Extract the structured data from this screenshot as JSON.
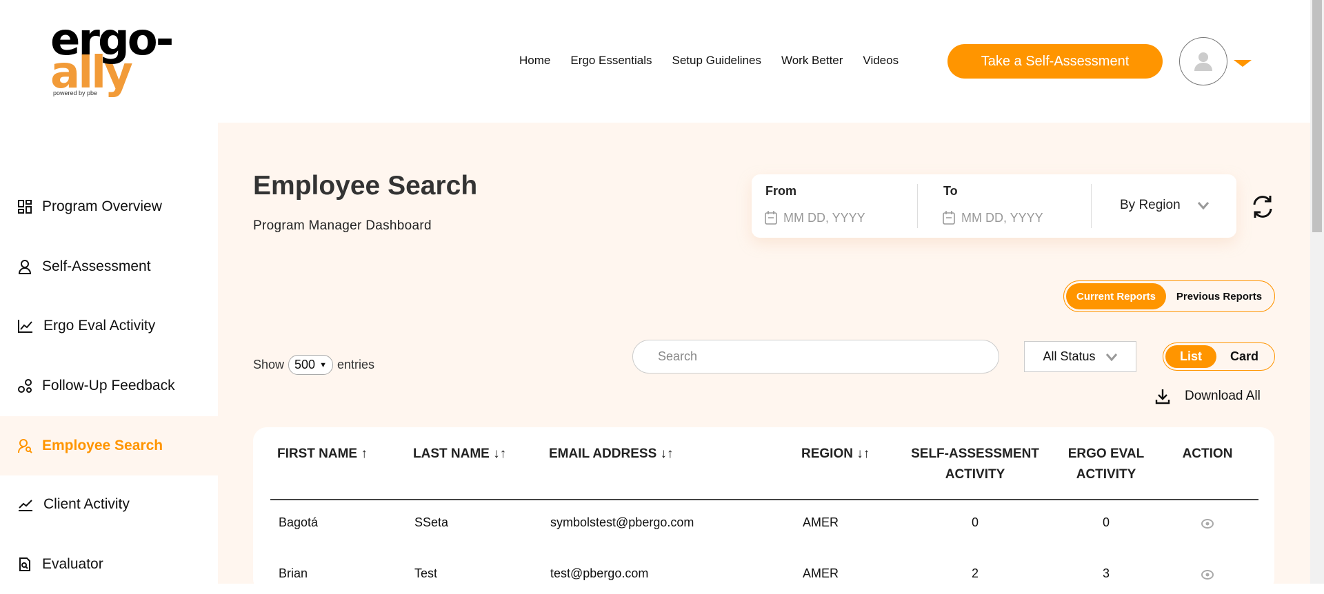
{
  "logo": {
    "line1": "ergo-",
    "line2": "ally",
    "tagline": "powered by pbe"
  },
  "nav": [
    "Home",
    "Ergo Essentials",
    "Setup Guidelines",
    "Work Better",
    "Videos"
  ],
  "cta": "Take a Self-Assessment",
  "sidebar": [
    {
      "label": "Program Overview",
      "icon": "grid-icon"
    },
    {
      "label": "Self-Assessment",
      "icon": "user-icon"
    },
    {
      "label": "Ergo Eval Activity",
      "icon": "chart-line-icon"
    },
    {
      "label": "Follow-Up Feedback",
      "icon": "nodes-icon"
    },
    {
      "label": "Employee Search",
      "icon": "user-search-icon",
      "active": true
    },
    {
      "label": "Client Activity",
      "icon": "trend-icon"
    },
    {
      "label": "Evaluator",
      "icon": "doc-search-icon"
    }
  ],
  "page": {
    "title": "Employee Search",
    "subtitle": "Program Manager Dashboard"
  },
  "filters": {
    "from_label": "From",
    "to_label": "To",
    "date_placeholder": "MM DD, YYYY",
    "region": "By Region"
  },
  "reports": {
    "current": "Current Reports",
    "previous": "Previous Reports"
  },
  "entries": {
    "show": "Show",
    "value": "500",
    "suffix": "entries"
  },
  "search": {
    "placeholder": "Search"
  },
  "status": "All Status",
  "view": {
    "list": "List",
    "card": "Card"
  },
  "download": "Download All",
  "table": {
    "headers": [
      "FIRST NAME",
      "LAST NAME",
      "EMAIL ADDRESS",
      "REGION",
      "SELF-ASSESSMENT",
      "ACTIVITY",
      "ERGO EVAL",
      "ACTIVITY",
      "ACTION"
    ],
    "sort": {
      "first": "↑",
      "other": "↓↑"
    },
    "rows": [
      [
        "Bagotá",
        "SSeta",
        "symbolstest@pbergo.com",
        "AMER",
        "0",
        "0"
      ],
      [
        "Brian",
        "Test",
        "test@pbergo.com",
        "AMER",
        "2",
        "3"
      ]
    ]
  },
  "colors": {
    "accent": "#ff9500",
    "background": "#fff6ef"
  }
}
